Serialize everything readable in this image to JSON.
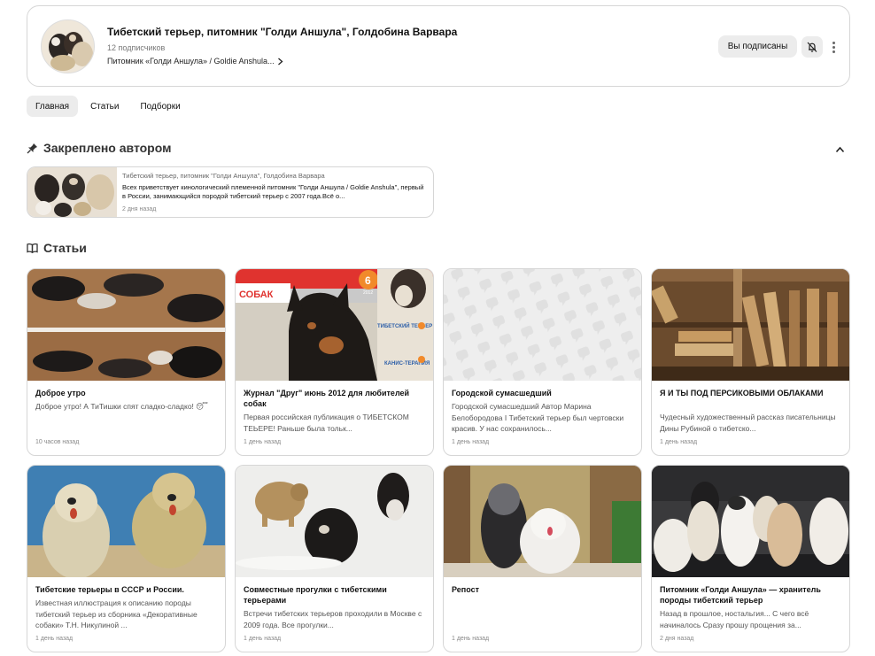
{
  "channel": {
    "title": "Тибетский терьер, питомник \"Голди Аншула\", Голдобина Варвара",
    "subscribers": "12 подписчиков",
    "link": "Питомник «Голди Аншула» / Goldie Anshula...",
    "subscribed_label": "Вы подписаны",
    "bell_icon": "bell-muted-icon",
    "more_icon": "more-vertical-icon"
  },
  "tabs": [
    {
      "label": "Главная",
      "active": true
    },
    {
      "label": "Статьи",
      "active": false
    },
    {
      "label": "Подборки",
      "active": false
    }
  ],
  "pinned": {
    "heading": "Закреплено автором",
    "icon": "pin-icon",
    "collapse_icon": "chevron-up-icon",
    "source": "Тибетский терьер, питомник \"Голди Аншула\", Голдобина Варвара",
    "text": "Всех приветствует кинологический племенной питомник \"Голди Аншула / Goldie Anshula\", первый в России, занимающийся породой тибетский терьер с 2007 года.Всё о...",
    "time": "2 дня назад"
  },
  "articles": {
    "heading": "Статьи",
    "icon": "book-icon",
    "items": [
      {
        "title": "Доброе утро",
        "desc": "Доброе утро! А ТиТишки спят сладко-сладко! 😴",
        "time": "10 часов назад"
      },
      {
        "title": "Журнал \"Друг\" июнь 2012 для любителей собак",
        "desc": "Первая российская публикация о ТИБЕТСКОМ ТЕЬЕРЕ!  Раньше была тольк...",
        "time": "1 день назад"
      },
      {
        "title": "Городской сумасшедший",
        "desc": "Городской сумасшедший Автор Марина Белобородова I Тибетский терьер был чертовски красив. У нас сохранилось...",
        "time": "1 день назад"
      },
      {
        "title": "Я И ТЫ ПОД ПЕРСИКОВЫМИ ОБЛАКАМИ",
        "desc": "Чудесный художественный рассказ писательницы Дины Рубиной о тибетско...",
        "time": "1 день назад"
      },
      {
        "title": "Тибетские терьеры в СССР и России.",
        "desc": "Известная иллюстрация к описанию породы тибетский терьер из сборника «Декоративные собаки» Т.Н. Никулиной ...",
        "time": "1 день назад"
      },
      {
        "title": "Совместные прогулки с тибетскими терьерами",
        "desc": "Встречи тибетских терьеров проходили в Москве с 2009 года. Все прогулки...",
        "time": "1 день назад"
      },
      {
        "title": "Репост",
        "desc": "",
        "time": "1 день назад"
      },
      {
        "title": "Питомник «Голди Аншула» — хранитель породы тибетский терьер",
        "desc": "Назад в прошлое, ностальгия... С чего всё начиналось Сразу прошу прощения за...",
        "time": "2 дня назад"
      }
    ]
  },
  "magazine_cover": {
    "issue_number": "6",
    "year": "2012",
    "masthead": "СОБАК",
    "headline_1": "ТИБЕТСКИЙ ТЕРЬЕР",
    "headline_2": "КАНИС-ТЕРАПИЯ"
  },
  "colors": {
    "accent_bg": "#ececec",
    "border": "#d6d6d6",
    "magazine_red": "#e0332f",
    "repost_placeholder": "#eeeeee"
  }
}
